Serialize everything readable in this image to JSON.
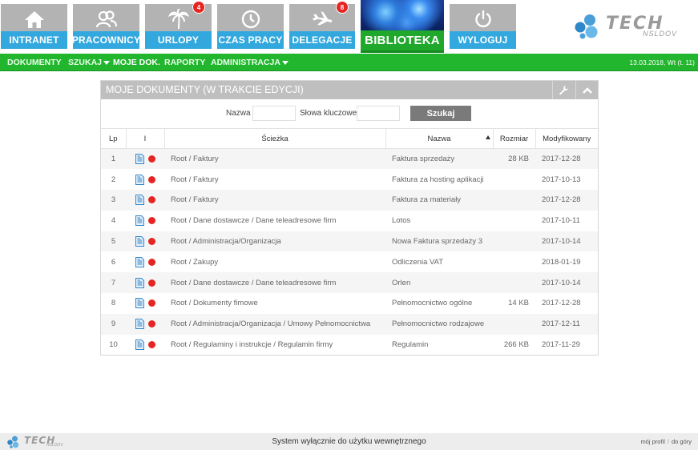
{
  "tiles": [
    {
      "key": "intranet",
      "label": "INTRANET",
      "icon": "home-icon",
      "badge": null
    },
    {
      "key": "pracownicy",
      "label": "PRACOWNICY",
      "icon": "people-icon",
      "badge": null
    },
    {
      "key": "urlopy",
      "label": "URLOPY",
      "icon": "palm-icon",
      "badge": "4"
    },
    {
      "key": "czas_pracy",
      "label": "CZAS PRACY",
      "icon": "clock-icon",
      "badge": null
    },
    {
      "key": "delegacje",
      "label": "DELEGACJE",
      "icon": "plane-icon",
      "badge": "8"
    },
    {
      "key": "biblioteka",
      "label": "BIBLIOTEKA",
      "icon": "library-image",
      "badge": null,
      "active": true
    },
    {
      "key": "wyloguj",
      "label": "WYLOGUJ",
      "icon": "power-icon",
      "badge": null
    }
  ],
  "logo": {
    "text": "TECH",
    "sub": "NSLDOV"
  },
  "nav": {
    "items": [
      {
        "label": "DOKUMENTY",
        "dropdown": false
      },
      {
        "label": "SZUKAJ",
        "dropdown": true
      },
      {
        "label": "MOJE DOK.",
        "dropdown": false
      },
      {
        "label": "RAPORTY",
        "dropdown": false
      },
      {
        "label": "ADMINISTRACJA",
        "dropdown": true
      }
    ],
    "date": "13.03.2018, Wt (t. 11)"
  },
  "panel": {
    "title": "MOJE DOKUMENTY (W TRAKCIE EDYCJI)",
    "search": {
      "name_label": "Nazwa",
      "name_value": "",
      "keywords_label": "Słowa kluczowe",
      "keywords_value": "",
      "button": "Szukaj"
    },
    "columns": [
      "Lp",
      "I",
      "Ścieżka",
      "Nazwa",
      "Rozmiar",
      "Modyfikowany"
    ],
    "rows": [
      {
        "lp": "1",
        "path": "Root / Faktury",
        "name": "Faktura sprzedaży",
        "size": "28 KB",
        "modified": "2017-12-28"
      },
      {
        "lp": "2",
        "path": "Root / Faktury",
        "name": "Faktura za hosting aplikacji",
        "size": "",
        "modified": "2017-10-13"
      },
      {
        "lp": "3",
        "path": "Root / Faktury",
        "name": "Faktura za materiały",
        "size": "",
        "modified": "2017-12-28"
      },
      {
        "lp": "4",
        "path": "Root / Dane dostawcze / Dane teleadresowe firm",
        "name": "Lotos",
        "size": "",
        "modified": "2017-10-11"
      },
      {
        "lp": "5",
        "path": "Root / Administracja/Organizacja",
        "name": "Nowa Faktura sprzedaży 3",
        "size": "",
        "modified": "2017-10-14"
      },
      {
        "lp": "6",
        "path": "Root / Zakupy",
        "name": "Odliczenia VAT",
        "size": "",
        "modified": "2018-01-19"
      },
      {
        "lp": "7",
        "path": "Root / Dane dostawcze / Dane teleadresowe firm",
        "name": "Orlen",
        "size": "",
        "modified": "2017-10-14"
      },
      {
        "lp": "8",
        "path": "Root / Dokumenty fimowe",
        "name": "Pełnomocnictwo ogólne",
        "size": "14 KB",
        "modified": "2017-12-28"
      },
      {
        "lp": "9",
        "path": "Root / Administracja/Organizacja / Umowy Pełnomocnictwa",
        "name": "Pełnomocnictwo rodzajowe",
        "size": "",
        "modified": "2017-12-11"
      },
      {
        "lp": "10",
        "path": "Root / Regulaminy i instrukcje / Regulamin firmy",
        "name": "Regulamin",
        "size": "266 KB",
        "modified": "2017-11-29"
      }
    ]
  },
  "footer": {
    "logo_text": "TECH",
    "logo_sub": "NSLDOV",
    "center": "System wyłącznie do użytku wewnętrznego",
    "link_profile": "mój profil",
    "link_sep": "/",
    "link_top": "do góry"
  },
  "colors": {
    "tile_gray": "#b3b3b3",
    "tile_blue": "#32a8de",
    "green": "#22b52e",
    "red_dot": "#e52521"
  }
}
